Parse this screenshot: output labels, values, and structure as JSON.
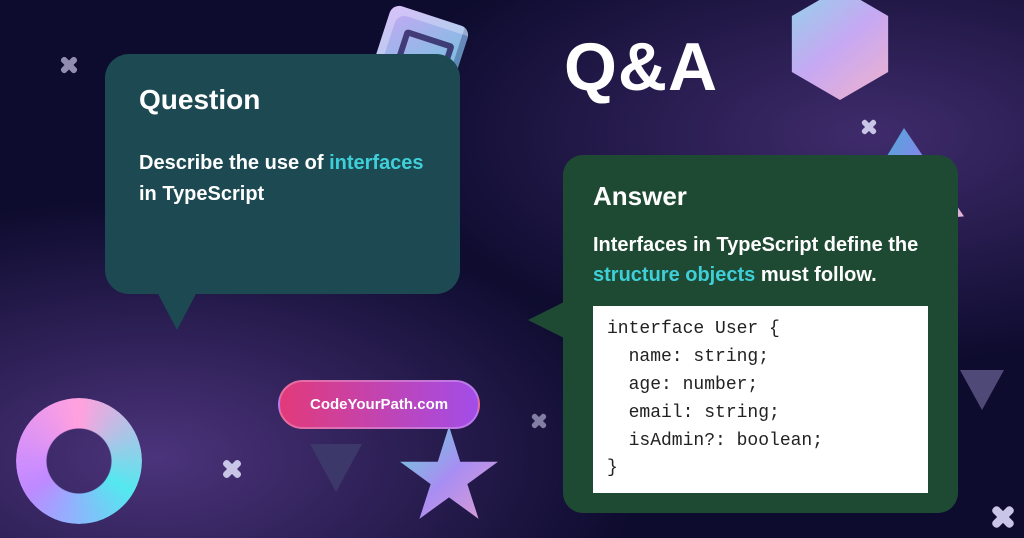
{
  "qa_title": "Q&A",
  "question": {
    "heading": "Question",
    "prefix": "Describe the use of ",
    "highlight": "interfaces",
    "suffix": " in TypeScript"
  },
  "answer": {
    "heading": "Answer",
    "line_prefix": "Interfaces in TypeScript define the ",
    "highlight": "structure objects",
    "line_suffix": " must follow.",
    "code": "interface User {\n  name: string;\n  age: number;\n  email: string;\n  isAdmin?: boolean;\n}"
  },
  "badge": "CodeYourPath.com"
}
